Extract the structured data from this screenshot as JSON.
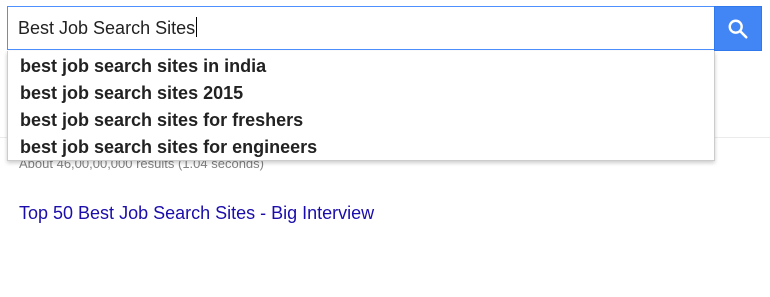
{
  "search": {
    "query": "Best Job Search Sites"
  },
  "suggestions": [
    "best job search sites in india",
    "best job search sites 2015",
    "best job search sites for freshers",
    "best job search sites for engineers"
  ],
  "results": {
    "stats": "About 46,00,00,000 results (1.04 seconds)",
    "first_title": "Top 50 Best Job Search Sites - Big Interview"
  },
  "colors": {
    "search_button": "#4285f4",
    "link": "#1a0dab",
    "focus_border": "#4d90fe"
  },
  "icons": {
    "search_button": "search-icon"
  }
}
